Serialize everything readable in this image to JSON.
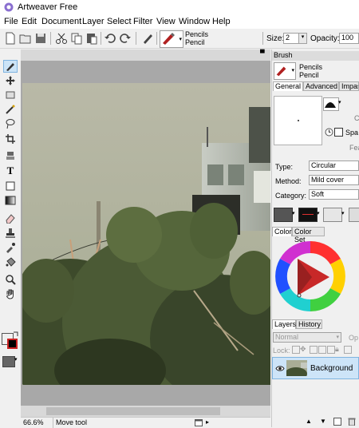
{
  "app": {
    "title": "Artweaver Free"
  },
  "menu": [
    "File",
    "Edit",
    "Document",
    "Layer",
    "Select",
    "Filter",
    "View",
    "Window",
    "Help"
  ],
  "toolbar": {
    "preset_category": "Pencils",
    "preset_name": "Pencil",
    "size_label": "Size:",
    "size_value": "2",
    "opacity_label": "Opacity:",
    "opacity_value": "100"
  },
  "status": {
    "zoom": "66.6%",
    "tool": "Move tool"
  },
  "brush_panel": {
    "title": "Brush",
    "category": "Pencils",
    "name": "Pencil",
    "tabs": [
      "General",
      "Advanced",
      "Impas"
    ],
    "selected_tab": "General",
    "side_fragments": [
      "C",
      "Spa",
      "Fea"
    ],
    "type_label": "Type:",
    "type_value": "Circular",
    "method_label": "Method:",
    "method_value": "Mild cover",
    "category_label": "Category:",
    "category_value": "Soft"
  },
  "color_panel": {
    "tabs": [
      "Color",
      "Color Set"
    ],
    "selected_tab": "Color",
    "foreground": "#ffffff",
    "background": "#000000",
    "accent": "#cc2222"
  },
  "layers_panel": {
    "tabs": [
      "Layers",
      "History"
    ],
    "selected_tab": "Layers",
    "blend_mode": "Normal",
    "opacity_fragment": "Op",
    "lock_label": "Lock:",
    "layers": [
      {
        "name": "Background",
        "visible": true,
        "selected": true
      }
    ]
  },
  "tools": [
    "brush-tool",
    "move-tool",
    "rectangle-select-tool",
    "magic-wand-tool",
    "lasso-tool",
    "crop-tool",
    "clone-tool",
    "text-tool",
    "gradient-tool",
    "fill-tool",
    "eraser-tool",
    "stamp-tool",
    "eyedropper-tool",
    "bucket-tool",
    "zoom-tool",
    "hand-tool"
  ]
}
